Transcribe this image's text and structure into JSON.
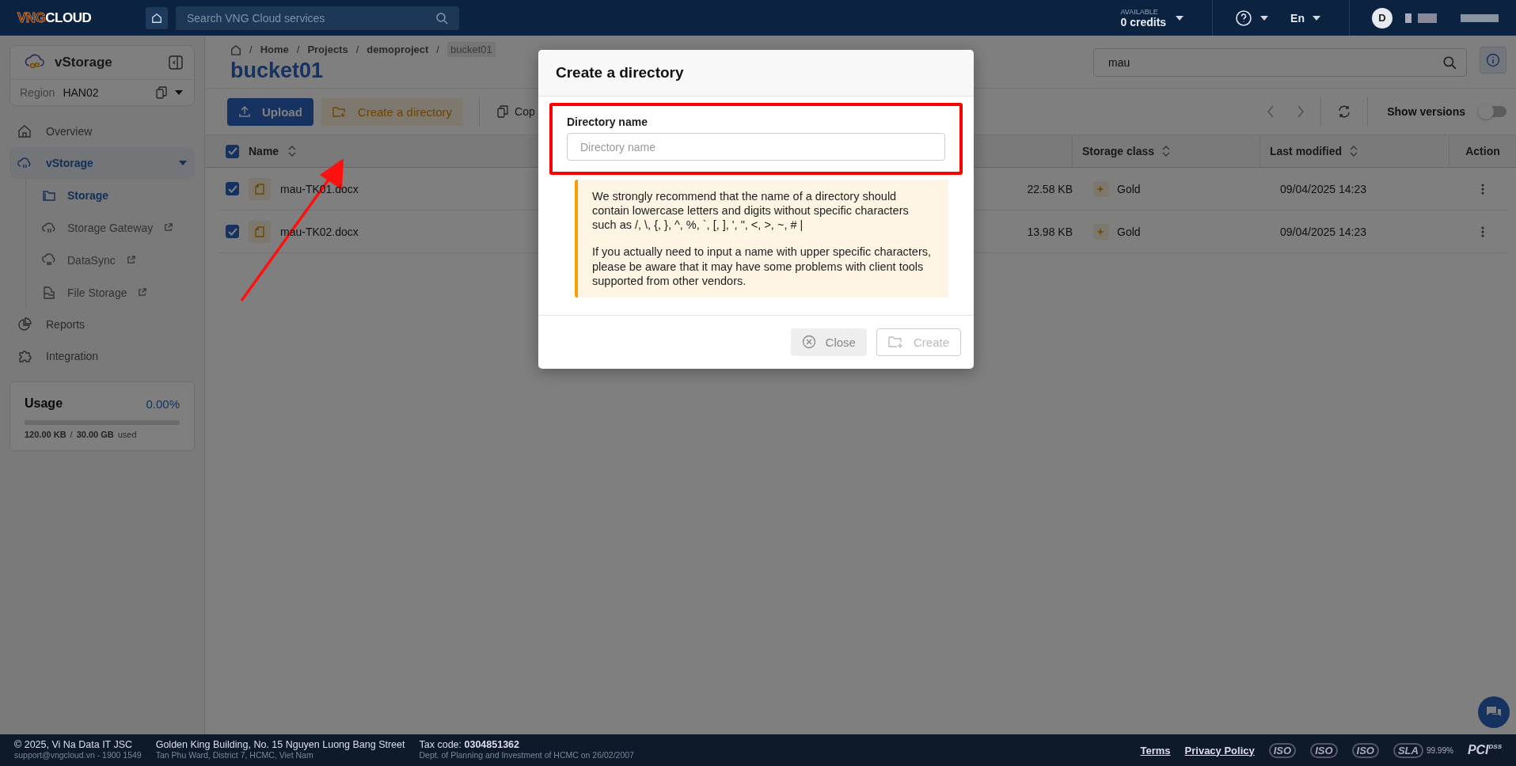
{
  "header": {
    "logo_mark": "VNG",
    "logo_text": "CLOUD",
    "search": {
      "placeholder": "Search VNG Cloud services"
    },
    "credits_label": "AVAILABLE",
    "credits": "0 credits",
    "language": "En",
    "avatar": "D"
  },
  "sidebar": {
    "service": "vStorage",
    "region_label": "Region",
    "region": "HAN02",
    "items": [
      {
        "label": "Overview",
        "kind": "home",
        "selected": false
      },
      {
        "label": "vStorage",
        "kind": "cloud",
        "selected": true,
        "expanded": true,
        "children": [
          {
            "label": "Storage",
            "kind": "folder",
            "selected": true,
            "external": false
          },
          {
            "label": "Storage Gateway",
            "kind": "cloud",
            "selected": false,
            "external": true
          },
          {
            "label": "DataSync",
            "kind": "sync",
            "selected": false,
            "external": true
          },
          {
            "label": "File Storage",
            "kind": "file",
            "selected": false,
            "external": true
          }
        ]
      },
      {
        "label": "Reports",
        "kind": "pie",
        "selected": false
      },
      {
        "label": "Integration",
        "kind": "puzzle",
        "selected": false
      }
    ],
    "usage": {
      "title": "Usage",
      "percent": "0.00%",
      "level": 0,
      "used": "120.00 KB",
      "separator": "/",
      "total": "30.00 GB",
      "suffix": "used"
    }
  },
  "main": {
    "breadcrumb_separator": "/",
    "breadcrumb": [
      "Home",
      "Projects",
      "demoproject",
      "bucket01"
    ],
    "title": "bucket01",
    "search": {
      "value": "mau"
    },
    "toolbar": {
      "upload": "Upload",
      "create": "Create a directory",
      "copy": "Cop",
      "show_versions": {
        "label": "Show versions",
        "on": false
      }
    },
    "table": {
      "columns": [
        "Name",
        "Storage class",
        "Last modified",
        "Action"
      ],
      "all_checked": true,
      "rows": [
        {
          "checked": true,
          "name": "mau-TK01.docx",
          "size": "22.58 KB",
          "storage_class": "Gold",
          "modified": "09/04/2025 14:23"
        },
        {
          "checked": true,
          "name": "mau-TK02.docx",
          "size": "13.98 KB",
          "storage_class": "Gold",
          "modified": "09/04/2025 14:23"
        }
      ]
    }
  },
  "dialog": {
    "title": "Create a directory",
    "field_label": "Directory name",
    "placeholder": "Directory name",
    "notice": [
      "We strongly recommend that the name of a directory should contain lowercase letters and digits without specific characters such as /, \\, {, }, ^, %, `, [, ], ', \", <, >, ~, # |",
      "If you actually need to input a name with upper specific characters, please be aware that it may have some problems with client tools supported from other vendors."
    ],
    "buttons": [
      {
        "label": "Close",
        "kind": "close",
        "disabled": false
      },
      {
        "label": "Create",
        "kind": "create",
        "disabled": true
      }
    ]
  },
  "annotations": {
    "highlight_box": true,
    "arrow": true
  },
  "footer": {
    "company": "© 2025, Vi Na Data IT JSC",
    "contact": "support@vngcloud.vn - 1900 1549",
    "address": "Golden King Building, No. 15 Nguyen Luong Bang Street",
    "address_2": "Tan Phu Ward, District 7, HCMC, Viet Nam",
    "tax": "Tax code: **0304851362**",
    "tax_note": "Dept. of Planning and Investment of HCMC on 26/02/2007",
    "links": [
      "Terms",
      "Privacy Policy"
    ],
    "badges": [
      "ISO",
      "ISO",
      "ISO",
      "SLA"
    ],
    "sla": "99.99%",
    "pci": "PCI",
    "dss": "DSS"
  }
}
